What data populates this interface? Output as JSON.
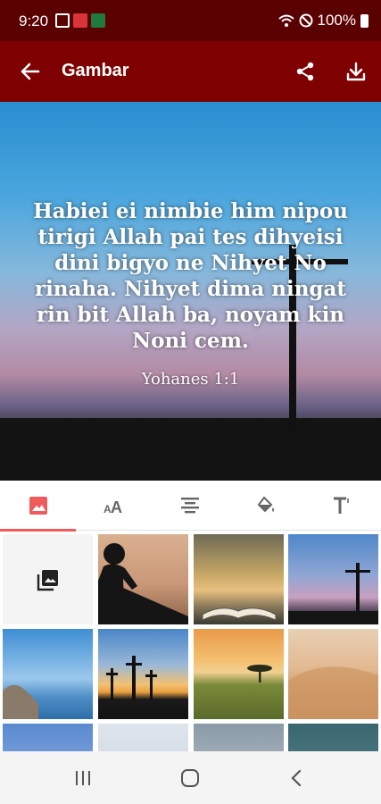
{
  "status_bar": {
    "time": "9:20",
    "battery": "100%"
  },
  "app_bar": {
    "title": "Gambar"
  },
  "preview": {
    "verse": "Habiei ei nimbie him nipou tirigi Allah pai tes dihyeisi dini bigyo ne Nihyet No rinaha. Nihyet dima ningat rin bit Allah ba, noyam kin Noni cem.",
    "reference": "Yohanes 1:1"
  },
  "tabs": [
    {
      "icon": "image-icon",
      "selected": true
    },
    {
      "icon": "text-size-icon",
      "selected": false
    },
    {
      "icon": "align-center-icon",
      "selected": false
    },
    {
      "icon": "paint-bucket-icon",
      "selected": false
    },
    {
      "icon": "font-style-icon",
      "selected": false
    }
  ],
  "colors": {
    "status_bar": "#5b0000",
    "app_bar": "#7e0000",
    "accent": "#ef5a5a"
  },
  "thumbnails": [
    "gallery-picker",
    "child-reading-silhouette",
    "open-bible-sunset",
    "cross-at-dusk",
    "lake-with-rocks",
    "three-crosses-sunset",
    "savanna-tree-sunset",
    "desert-dunes",
    "blue-sky-clouds",
    "pale-sky",
    "cloudy-hills",
    "dark-teal-sky"
  ]
}
